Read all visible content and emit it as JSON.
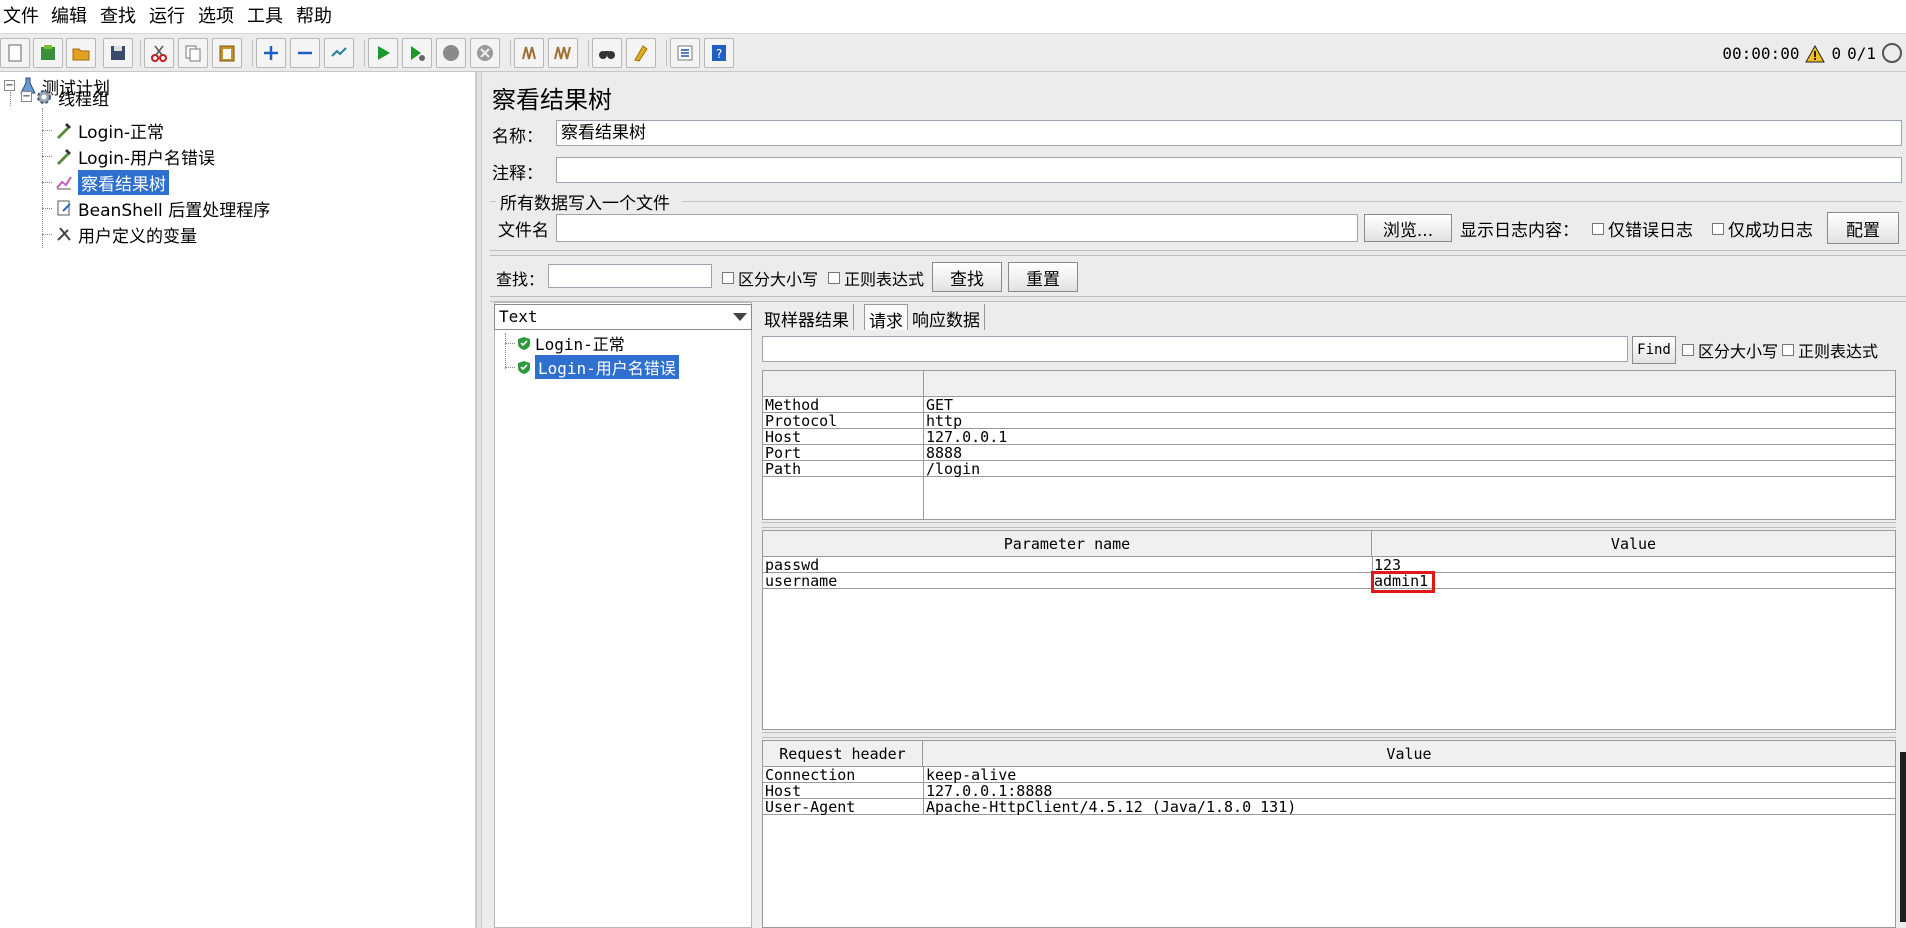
{
  "menu": [
    "文件",
    "编辑",
    "查找",
    "运行",
    "选项",
    "工具",
    "帮助"
  ],
  "toolbar": {
    "timer": "00:00:00",
    "warnings": "0",
    "threads": "0/1"
  },
  "tree": {
    "root": "测试计划",
    "thread_group": "线程组",
    "items": [
      "Login-正常",
      "Login-用户名错误",
      "察看结果树",
      "BeanShell 后置处理程序",
      "用户定义的变量"
    ]
  },
  "panel": {
    "title": "察看结果树",
    "name_label": "名称：",
    "name_value": "察看结果树",
    "comment_label": "注释：",
    "comment_value": "",
    "file_group_title": "所有数据写入一个文件",
    "filename_label": "文件名",
    "filename_value": "",
    "browse_button": "浏览...",
    "log_content_label": "显示日志内容：",
    "errors_only": "仅错误日志",
    "success_only": "仅成功日志",
    "config_button": "配置"
  },
  "search": {
    "label": "查找：",
    "value": "",
    "case_sensitive": "区分大小写",
    "regex": "正则表达式",
    "find_button": "查找",
    "reset_button": "重置"
  },
  "results": {
    "renderer": "Text",
    "samples": [
      "Login-正常",
      "Login-用户名错误"
    ]
  },
  "tabs": [
    "取样器结果",
    "请求",
    "响应数据"
  ],
  "request_search": {
    "value": "",
    "find_button": "Find",
    "case_sensitive": "区分大小写",
    "regex": "正则表达式"
  },
  "request_table": {
    "rows": [
      [
        "Method",
        "GET"
      ],
      [
        "Protocol",
        "http"
      ],
      [
        "Host",
        "127.0.0.1"
      ],
      [
        "Port",
        "8888"
      ],
      [
        "Path",
        "/login"
      ]
    ]
  },
  "params_table": {
    "headers": [
      "Parameter name",
      "Value"
    ],
    "rows": [
      [
        "passwd",
        "123"
      ],
      [
        "username",
        "admin1"
      ]
    ]
  },
  "headers_table": {
    "headers": [
      "Request header",
      "Value"
    ],
    "rows": [
      [
        "Connection",
        "keep-alive"
      ],
      [
        "Host",
        "127.0.0.1:8888"
      ],
      [
        "User-Agent",
        "Apache-HttpClient/4.5.12 (Java/1.8.0_131)"
      ]
    ]
  },
  "colors": {
    "selection": "#2f6fcf",
    "highlight": "#e01818",
    "panel_bg": "#ececec"
  }
}
